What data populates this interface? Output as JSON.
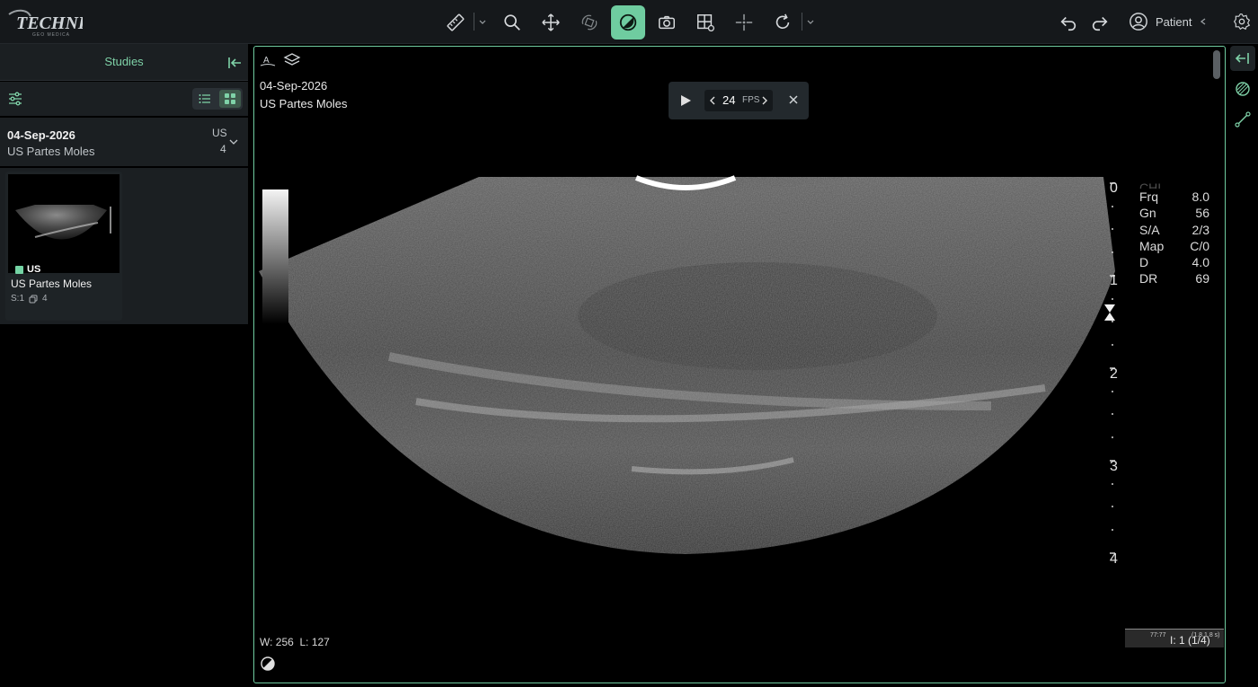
{
  "app": {
    "logo_text": "TECHNIK",
    "logo_subtext": "GEO MEDICA"
  },
  "toolbar": {
    "tools": [
      {
        "name": "measure-ruler",
        "icon": "ruler-icon",
        "has_menu": true
      },
      {
        "name": "zoom",
        "icon": "magnifier-icon"
      },
      {
        "name": "pan",
        "icon": "move-arrows-icon"
      },
      {
        "name": "rotate-3d",
        "icon": "rotate-cube-icon"
      },
      {
        "name": "window-level",
        "icon": "contrast-icon",
        "active": true
      },
      {
        "name": "capture",
        "icon": "camera-icon"
      },
      {
        "name": "layout",
        "icon": "grid-settings-icon"
      },
      {
        "name": "crosshair",
        "icon": "crosshair-icon"
      },
      {
        "name": "reset",
        "icon": "refresh-icon",
        "has_menu": true
      }
    ],
    "undo_icon": "undo-icon",
    "redo_icon": "redo-icon",
    "patient_label": "Patient",
    "settings_icon": "gear-icon",
    "accent_color": "#6fcca0"
  },
  "sidebar": {
    "title": "Studies",
    "study": {
      "date": "04-Sep-2026",
      "description": "US Partes Moles",
      "modality": "US",
      "instances": "4"
    },
    "series": [
      {
        "modality": "US",
        "description": "US Partes Moles",
        "series_label": "S:1",
        "instance_count": "4"
      }
    ]
  },
  "viewport": {
    "date": "04-Sep-2026",
    "description": "US Partes Moles",
    "cine": {
      "fps_value": "24",
      "fps_label": "FPS"
    },
    "params": [
      {
        "label": "CHI",
        "value": ""
      },
      {
        "label": "Frq",
        "value": "8.0"
      },
      {
        "label": "Gn",
        "value": "56"
      },
      {
        "label": "S/A",
        "value": "2/3"
      },
      {
        "label": "Map",
        "value": "C/0"
      },
      {
        "label": "D",
        "value": "4.0"
      },
      {
        "label": "DR",
        "value": "69"
      }
    ],
    "depth_labels": [
      "0",
      "1",
      "2",
      "3",
      "4"
    ],
    "window_width": "W: 256",
    "window_level": "L: 127",
    "frame_timestamp": "77:77",
    "frame_small": "(1.8.1.8 s)",
    "frame_indicator": "I: 1 (1/4)"
  }
}
